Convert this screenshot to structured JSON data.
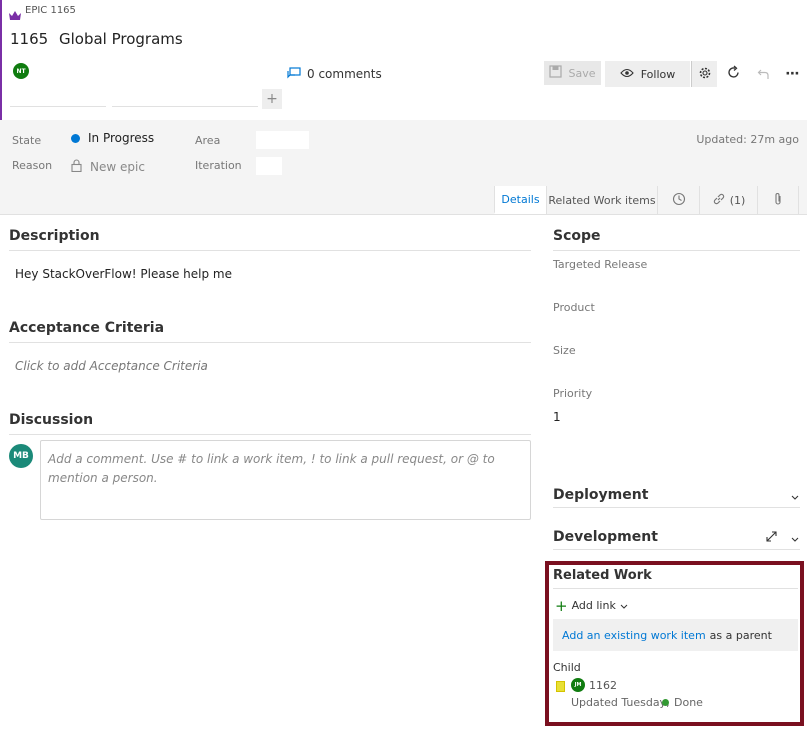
{
  "colors": {
    "accent": "#0078d4",
    "purple": "#7a2fa6",
    "green": "#107c10",
    "avatar_mb": "#1b8a79",
    "highlight": "#7a1020",
    "done": "#339933"
  },
  "header": {
    "type_label": "EPIC 1165",
    "id": "1165",
    "title": "Global Programs",
    "assignee_initials": "NT",
    "comments_label": "0 comments",
    "save_label": "Save",
    "follow_label": "Follow"
  },
  "fields": {
    "state_label": "State",
    "state_value": "In Progress",
    "reason_label": "Reason",
    "reason_value": "New epic",
    "area_label": "Area",
    "iteration_label": "Iteration",
    "updated": "Updated: 27m ago"
  },
  "tabs": {
    "details": "Details",
    "related": "Related Work items",
    "links": "(1)"
  },
  "description": {
    "title": "Description",
    "text": "Hey StackOverFlow! Please help me"
  },
  "acceptance": {
    "title": "Acceptance Criteria",
    "placeholder": "Click to add Acceptance Criteria"
  },
  "discussion": {
    "title": "Discussion",
    "avatar": "MB",
    "placeholder": "Add a comment. Use # to link a work item, ! to link a pull request, or @ to mention a person."
  },
  "scope": {
    "title": "Scope",
    "targeted_release": "Targeted Release",
    "product": "Product",
    "size": "Size",
    "priority": "Priority",
    "priority_value": "1"
  },
  "deployment": {
    "title": "Deployment"
  },
  "development": {
    "title": "Development"
  },
  "related_work": {
    "title": "Related Work",
    "add_link": "Add link",
    "existing_link": "Add an existing work item",
    "existing_suffix": "as a parent",
    "child_label": "Child",
    "child_avatar": "JM",
    "child_id": "1162",
    "child_updated": "Updated Tuesday,",
    "child_status": "Done"
  }
}
